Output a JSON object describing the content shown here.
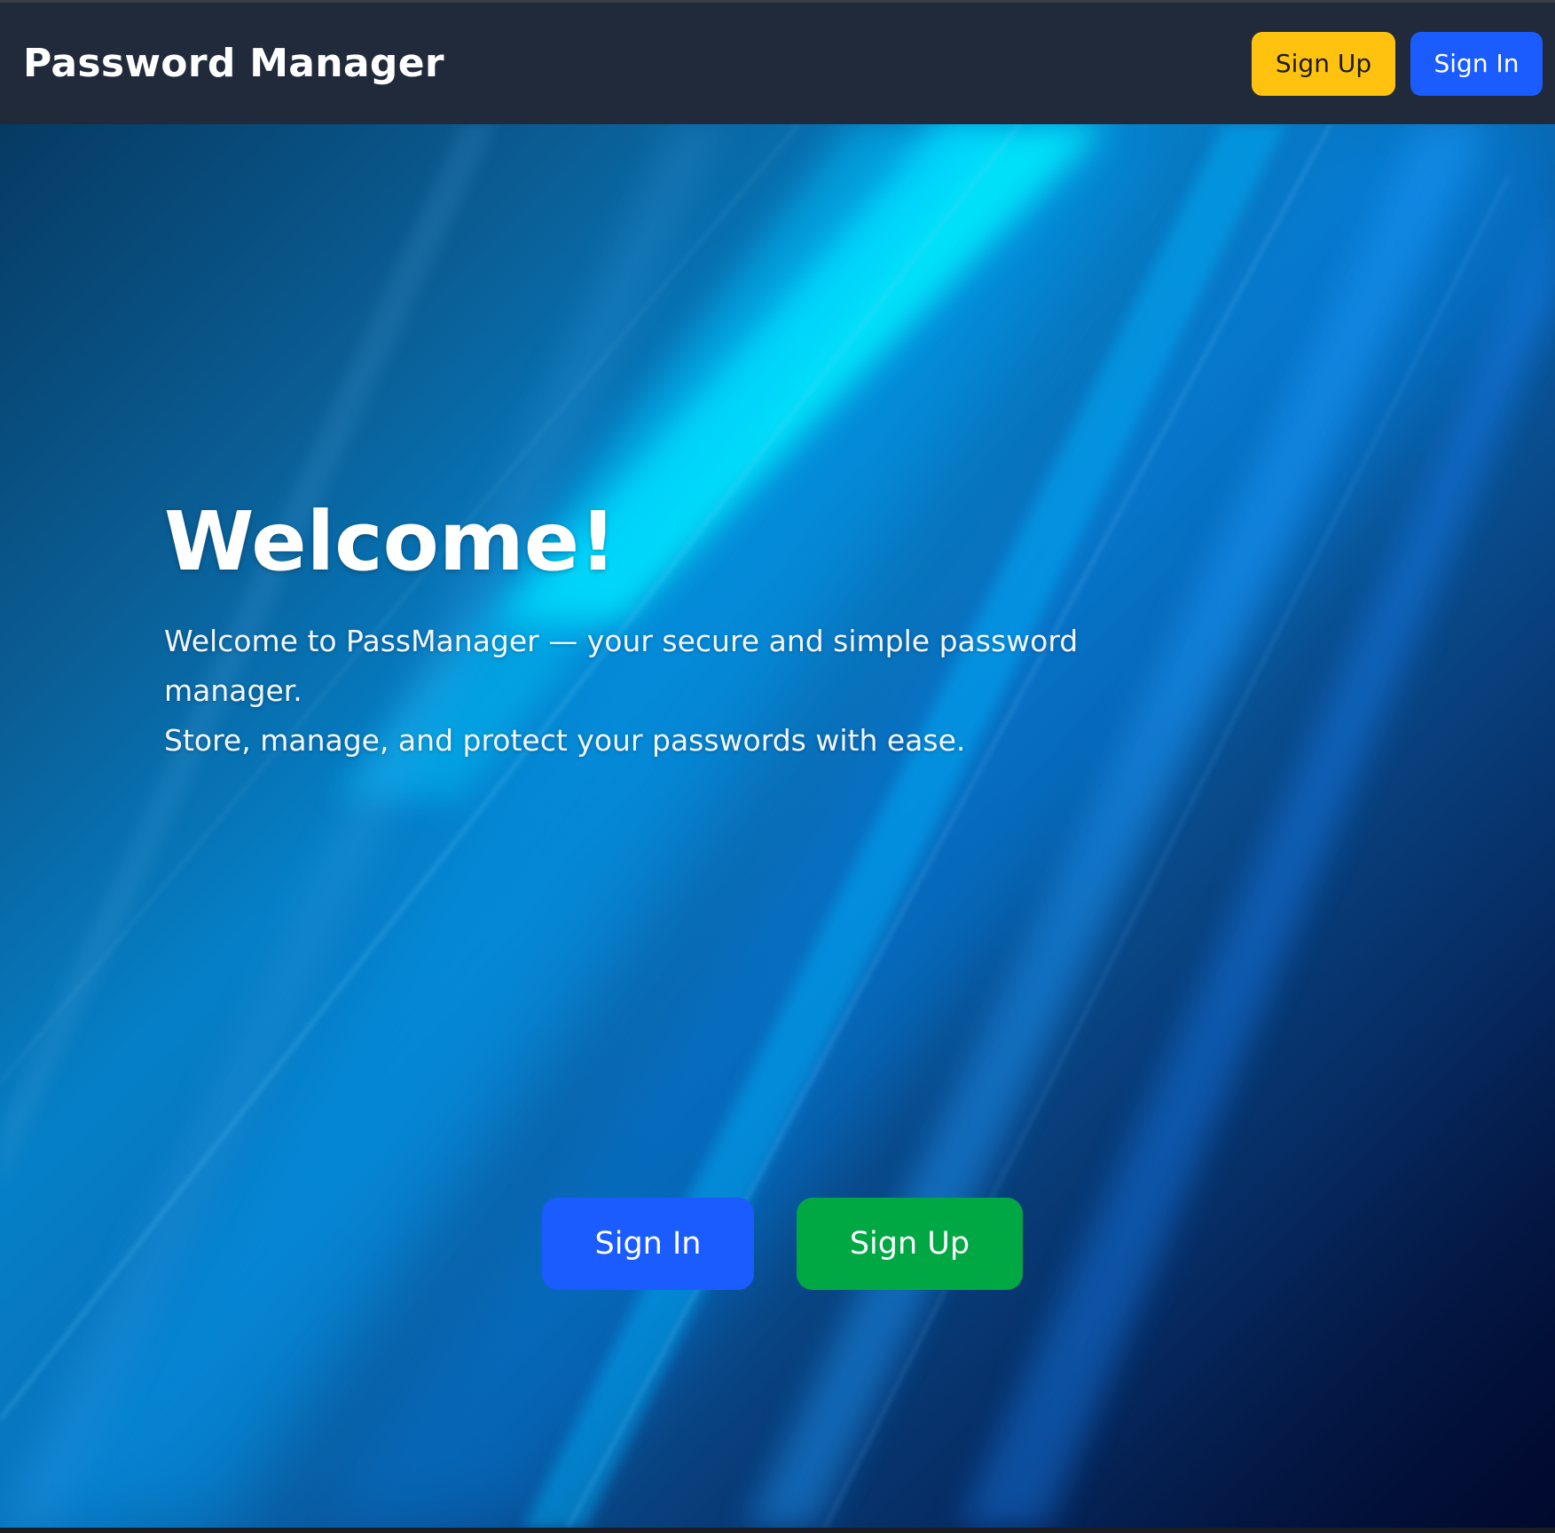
{
  "navbar": {
    "brand": "Password Manager",
    "signup_label": "Sign Up",
    "signin_label": "Sign In"
  },
  "hero": {
    "title": "Welcome!",
    "description_lines": [
      "Welcome to PassManager — your secure and simple password",
      "manager.",
      "Store, manage, and protect your passwords with ease."
    ],
    "signin_label": "Sign In",
    "signup_label": "Sign Up"
  },
  "colors": {
    "navbar_bg": "#212a3b",
    "signup_nav": "#ffc20e",
    "signin": "#1a5cff",
    "signup_cta": "#00a844"
  }
}
